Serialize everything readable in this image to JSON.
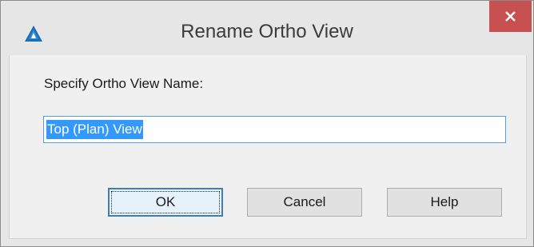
{
  "window": {
    "title": "Rename Ortho View",
    "app_icon": "autocad-icon",
    "close_icon": "close-icon",
    "close_color": "#c75050"
  },
  "dialog": {
    "prompt_label": "Specify Ortho View Name:",
    "name_field": {
      "value": "Top (Plan) View",
      "selected": true
    }
  },
  "buttons": {
    "ok_label": "OK",
    "cancel_label": "Cancel",
    "help_label": "Help"
  }
}
